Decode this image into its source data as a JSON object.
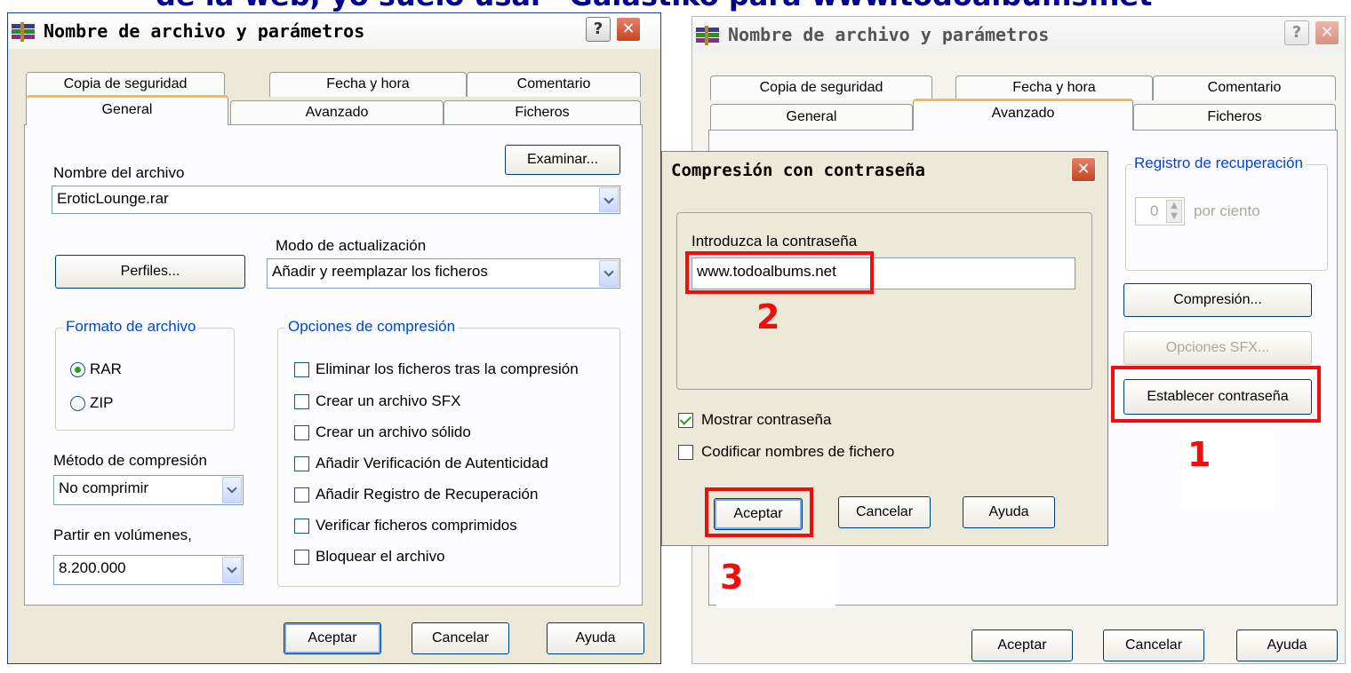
{
  "headline": "de la web, yo suelo usar \"Galastiko para www.todoalbums.net",
  "left": {
    "title": "Nombre de archivo y parámetros",
    "help": "?",
    "close": "✕",
    "tabs_back": [
      "Copia de seguridad",
      "Fecha y hora",
      "Comentario"
    ],
    "tabs_front": [
      "General",
      "Avanzado",
      "Ficheros"
    ],
    "filename_label": "Nombre del archivo",
    "browse": "Examinar...",
    "filename": "EroticLounge.rar",
    "update_label": "Modo de actualización",
    "profiles": "Perfiles...",
    "update_mode": "Añadir y reemplazar los ficheros",
    "format_legend": "Formato de archivo",
    "formats": [
      "RAR",
      "ZIP"
    ],
    "options_legend": "Opciones de compresión",
    "options": [
      "Eliminar los ficheros tras la compresión",
      "Crear un archivo SFX",
      "Crear un archivo sólido",
      "Añadir Verificación de Autenticidad",
      "Añadir Registro de Recuperación",
      "Verificar ficheros comprimidos",
      "Bloquear el archivo"
    ],
    "method_label": "Método de compresión",
    "method": "No comprimir",
    "split_label": "Partir en volúmenes,",
    "split": "8.200.000",
    "ok": "Aceptar",
    "cancel": "Cancelar",
    "help_btn": "Ayuda"
  },
  "right": {
    "title": "Nombre de archivo y parámetros",
    "help": "?",
    "close": "✕",
    "tabs_back": [
      "Copia de seguridad",
      "Fecha y hora",
      "Comentario"
    ],
    "tabs_front": [
      "General",
      "Avanzado",
      "Ficheros"
    ],
    "recovery_legend": "Registro de recuperación",
    "recovery_value": "0",
    "recovery_unit": "por ciento",
    "compression": "Compresión...",
    "sfx": "Opciones SFX...",
    "set_password": "Establecer contraseña",
    "ok": "Aceptar",
    "cancel": "Cancelar",
    "help_btn": "Ayuda"
  },
  "dialog": {
    "title": "Compresión con contraseña",
    "close": "✕",
    "prompt": "Introduzca la contraseña",
    "password": "www.todoalbums.net",
    "show_password": "Mostrar contraseña",
    "encrypt_names": "Codificar nombres de fichero",
    "ok": "Aceptar",
    "cancel": "Cancelar",
    "help_btn": "Ayuda"
  },
  "markers": [
    "1",
    "2",
    "3"
  ],
  "colors": {
    "marker_red": "#f20d0d",
    "legend_blue": "#0046d5",
    "accent_tab": "#f7b94a"
  }
}
